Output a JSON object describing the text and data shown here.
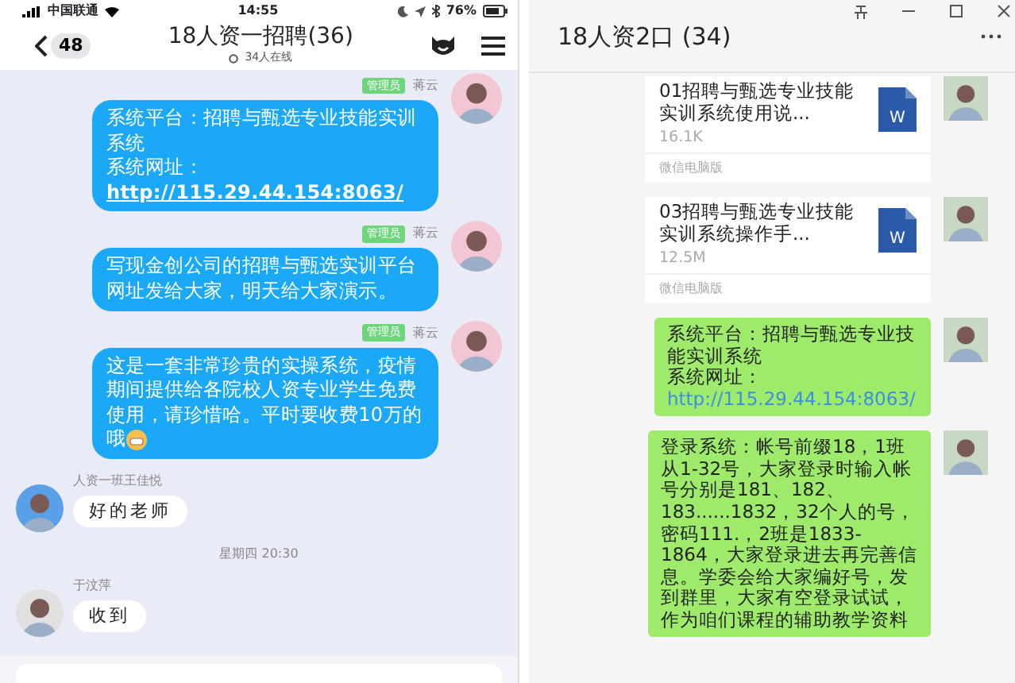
{
  "phone": {
    "status_bar": {
      "carrier": "中国联通",
      "time": "14:55",
      "battery": "76%"
    },
    "header": {
      "back_count": "48",
      "title": "18人资一招聘(36)",
      "subtitle": "34人在线"
    },
    "messages": [
      {
        "kind": "outgoing",
        "role": "管理员",
        "sender": "蒋云",
        "text": "系统平台：招聘与甄选专业技能实训系统",
        "label": "系统网址：",
        "link": "http://115.29.44.154:8063/"
      },
      {
        "kind": "outgoing",
        "role": "管理员",
        "sender": "蒋云",
        "text": "写现金创公司的招聘与甄选实训平台网址发给大家，明天给大家演示。"
      },
      {
        "kind": "outgoing",
        "role": "管理员",
        "sender": "蒋云",
        "text": "这是一套非常珍贵的实操系统，疫情期间提供给各院校人资专业学生免费使用，请珍惜哈。平时要收费10万的哦",
        "emoji": true
      },
      {
        "kind": "incoming",
        "sender": "人资一班王佳悦",
        "text": "好的老师"
      },
      {
        "kind": "time",
        "text": "星期四 20:30"
      },
      {
        "kind": "incoming",
        "sender": "于汶萍",
        "text": "收到"
      }
    ]
  },
  "desktop": {
    "title": "18人资2口 (34)",
    "messages": [
      {
        "kind": "file",
        "name": "01招聘与甄选专业技能实训系统使用说...",
        "size": "16.1K",
        "icon_letter": "W",
        "source": "微信电脑版"
      },
      {
        "kind": "file",
        "name": "03招聘与甄选专业技能实训系统操作手...",
        "size": "12.5M",
        "icon_letter": "W",
        "source": "微信电脑版"
      },
      {
        "kind": "text",
        "text": "系统平台：招聘与甄选专业技能实训系统",
        "label": "系统网址：",
        "link": "http://115.29.44.154:8063/"
      },
      {
        "kind": "text",
        "text": "登录系统：帐号前缀18，1班从1-32号，大家登录时输入帐号分别是181、182、183......1832，32个人的号，密码111.，2班是1833-1864，大家登录进去再完善信息。学委会给大家编好号，发到群里，大家有空登录试试，作为咱们课程的辅助教学资料"
      }
    ]
  }
}
